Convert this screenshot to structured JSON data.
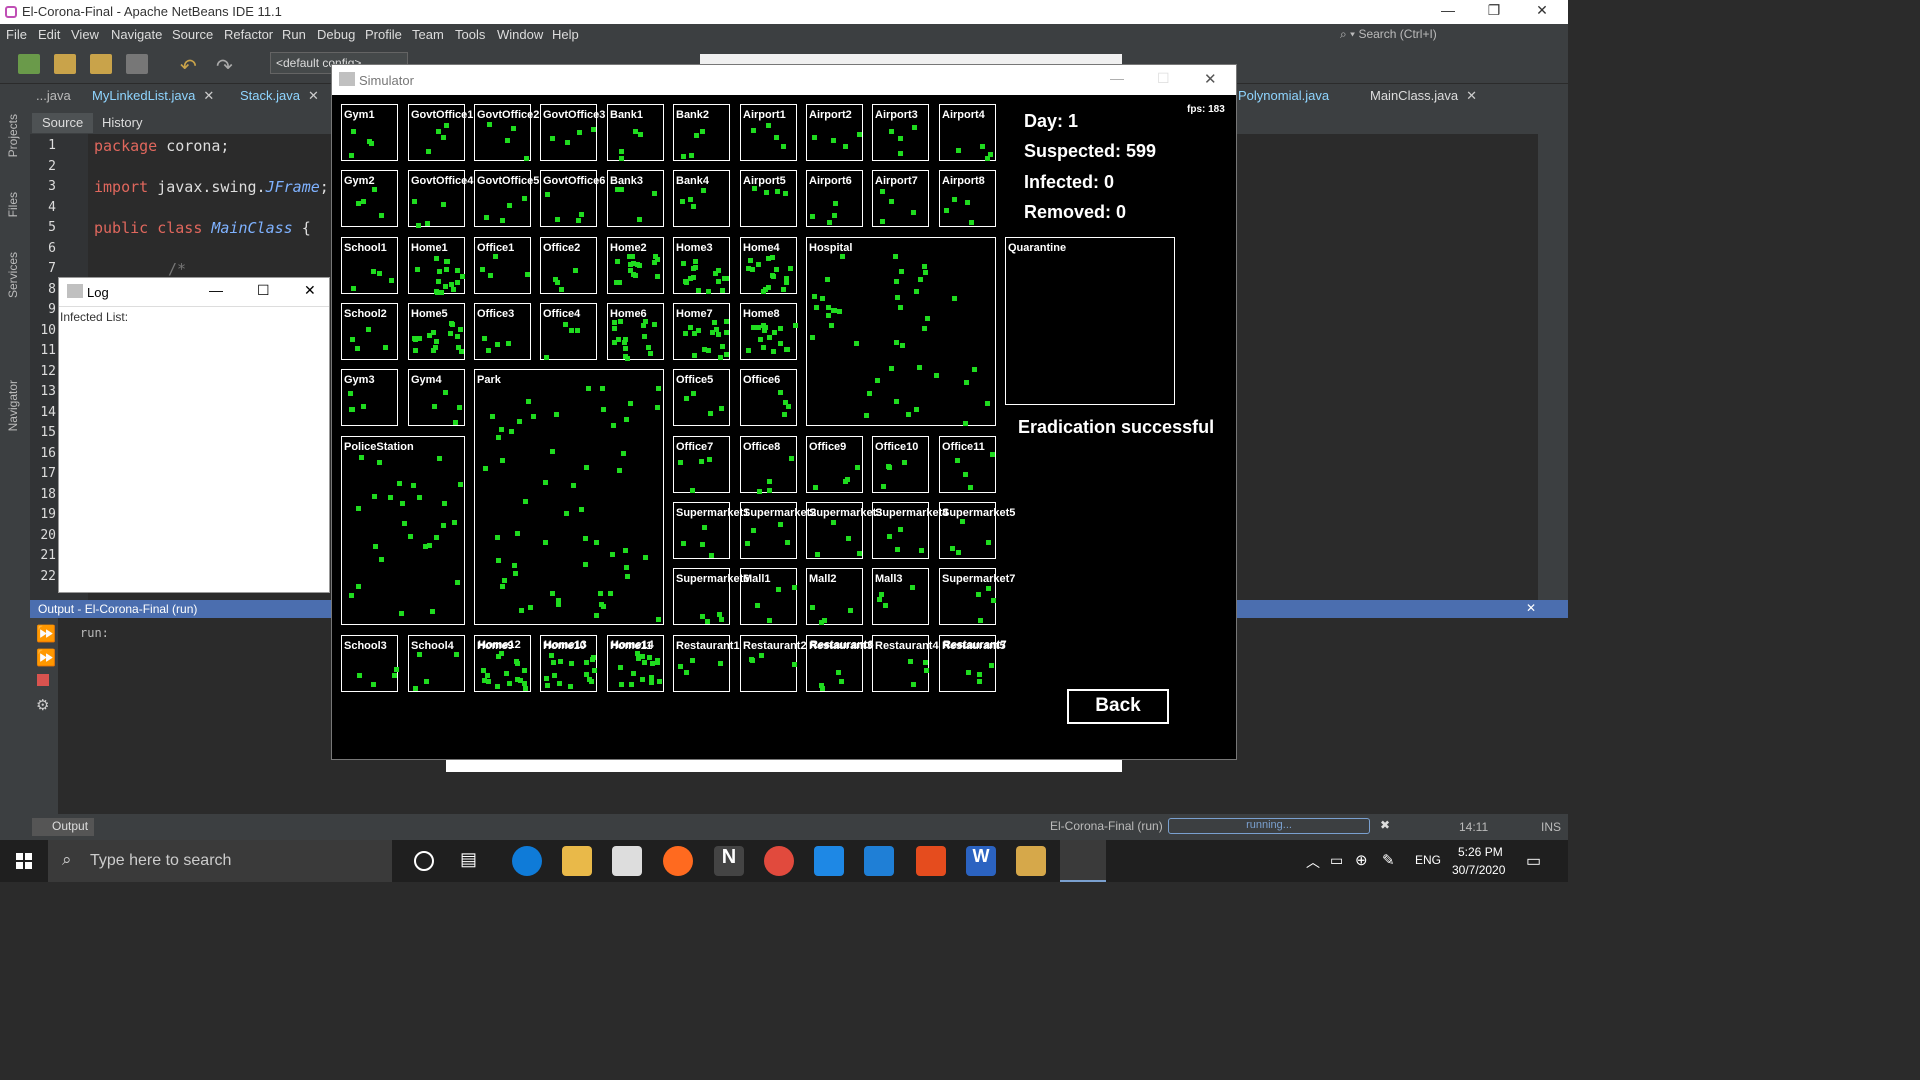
{
  "netbeans": {
    "title": "El-Corona-Final - Apache NetBeans IDE 11.1",
    "menu": [
      "File",
      "Edit",
      "View",
      "Navigate",
      "Source",
      "Refactor",
      "Run",
      "Debug",
      "Profile",
      "Team",
      "Tools",
      "Window",
      "Help"
    ],
    "search_placeholder": "Search (Ctrl+I)",
    "config": "<default config>",
    "tabs": [
      "...java",
      "MyLinkedList.java",
      "Stack.java",
      "Polynomial.java",
      "MainClass.java"
    ],
    "source_tab": "Source",
    "history_tab": "History",
    "side_labels": [
      "Projects",
      "Files",
      "Services",
      "Navigator"
    ],
    "line_numbers": [
      "1",
      "2",
      "3",
      "4",
      "5",
      "6",
      "7",
      "8",
      "9",
      "10",
      "11",
      "12",
      "13",
      "14",
      "15",
      "16",
      "17",
      "18",
      "19",
      "20",
      "21",
      "22"
    ],
    "code": {
      "l1_kw": "package",
      "l1_rest": " corona;",
      "l3_kw": "import",
      "l3_pkg": " javax.swing.",
      "l3_cls": "JFrame",
      "l3_end": ";",
      "l5_kw": "public class",
      "l5_cls": "MainClass",
      "l5_end": " {",
      "l7": "/*"
    },
    "output_title": "Output - El-Corona-Final (run)",
    "output_text": "run:",
    "output_tab": "Output",
    "status_project": "El-Corona-Final (run)",
    "status_progress": "running...",
    "status_pos": "14:11",
    "status_mode": "INS"
  },
  "log_window": {
    "title": "Log",
    "content": "Infected List:"
  },
  "simulator": {
    "title": "Simulator",
    "fps": "fps: 183",
    "day": "Day: 1",
    "suspected": "Suspected: 599",
    "infected": "Infected: 0",
    "removed": "Removed: 0",
    "eradication": "Eradication successful",
    "back_label": "Back",
    "quarantine_label": "Quarantine",
    "locations": [
      "Gym1",
      "GovtOffice1",
      "GovtOffice2",
      "GovtOffice3",
      "Bank1",
      "Bank2",
      "Airport1",
      "Airport2",
      "Airport3",
      "Airport4",
      "Gym2",
      "GovtOffice4",
      "GovtOffice5",
      "GovtOffice6",
      "Bank3",
      "Bank4",
      "Airport5",
      "Airport6",
      "Airport7",
      "Airport8",
      "School1",
      "Home1",
      "Office1",
      "Office2",
      "Home2",
      "Home3",
      "Home4",
      "Hospital",
      "School2",
      "Home5",
      "Office3",
      "Office4",
      "Home6",
      "Home7",
      "Home8",
      "Gym3",
      "Gym4",
      "Park",
      "Office5",
      "Office6",
      "PoliceStation",
      "Office7",
      "Office8",
      "Office9",
      "Office10",
      "Office11",
      "Supermarket1",
      "Supermarket2",
      "Supermarket3",
      "Supermarket4",
      "Supermarket5",
      "Supermarket6",
      "Mall1",
      "Mall2",
      "Mall3",
      "Supermarket7",
      "School3",
      "School4",
      "Home9",
      "Home10",
      "Home11",
      "Home12",
      "Home13",
      "Home14",
      "Restaurant1",
      "Restaurant2",
      "Restaurant3",
      "Restaurant4",
      "Restaurant5",
      "Restaurant6",
      "Restaurant7"
    ]
  },
  "taskbar": {
    "search_placeholder": "Type here to search",
    "lang": "ENG",
    "time": "5:26 PM",
    "date": "30/7/2020"
  }
}
